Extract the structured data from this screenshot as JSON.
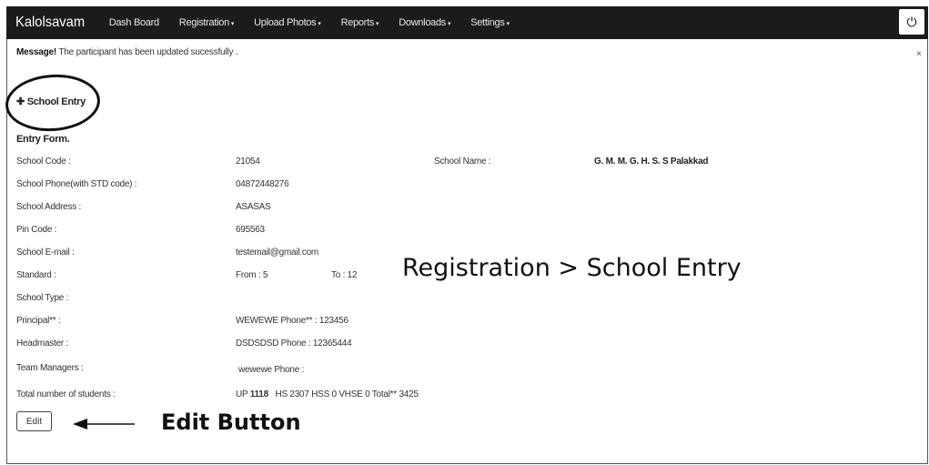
{
  "navbar": {
    "brand": "Kalolsavam",
    "items": [
      {
        "label": "Dash Board",
        "caret": false
      },
      {
        "label": "Registration",
        "caret": true
      },
      {
        "label": "Upload Photos",
        "caret": true
      },
      {
        "label": "Reports",
        "caret": true
      },
      {
        "label": "Downloads",
        "caret": true
      },
      {
        "label": "Settings",
        "caret": true
      }
    ],
    "caret_glyph": "▾",
    "power_glyph": "⏻"
  },
  "message": {
    "prefix": "Message!",
    "text": " The participant has been updated sucessfully .",
    "close": "×"
  },
  "school_entry": {
    "icon": "✚",
    "label": "School Entry"
  },
  "form": {
    "title": "Entry Form.",
    "school_code_label": "School Code :",
    "school_code": "21054",
    "school_name_label": "School Name :",
    "school_name": "G. M. M. G. H. S. S Palakkad",
    "phone_label": "School Phone(with STD code) :",
    "phone": "04872448276",
    "address_label": "School Address :",
    "address": "ASASAS",
    "pin_label": "Pin Code :",
    "pin": "695563",
    "email_label": "School E-mail :",
    "email": "testemail@gmail.com",
    "standard_label": "Standard :",
    "standard_from": "From : 5",
    "standard_to": "To : 12",
    "school_type_label": "School Type :",
    "principal_label": "Principal** :",
    "principal_value": "WEWEWE  Phone** : 123456",
    "headmaster_label": "Headmaster :",
    "headmaster_value": "DSDSDSD  Phone : 12365444",
    "team_label": "Team Managers :",
    "team_value": "wewewe   Phone :",
    "total_label": "Total number of students :",
    "total_up_label": "UP",
    "total_up": "1118",
    "total_rest": "HS 2307   HSS 0   VHSE 0   Total** 3425"
  },
  "edit_button": {
    "label": "Edit"
  },
  "annotations": {
    "registration_path": "Registration > School Entry",
    "edit_button": "Edit Button"
  }
}
